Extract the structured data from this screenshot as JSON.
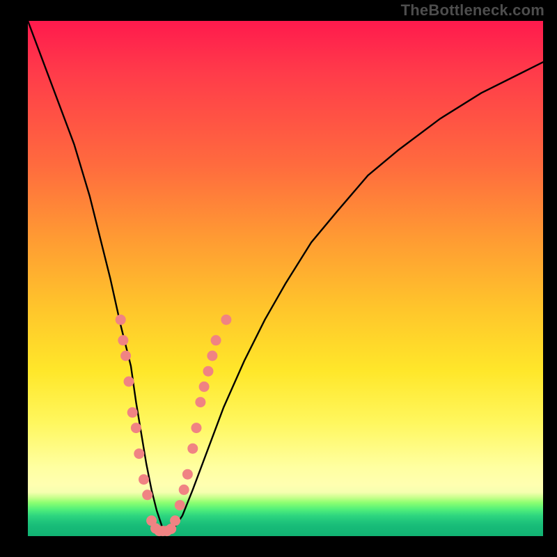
{
  "watermark": "TheBottleneck.com",
  "chart_data": {
    "type": "line",
    "title": "",
    "xlabel": "",
    "ylabel": "",
    "xlim": [
      0,
      100
    ],
    "ylim": [
      0,
      100
    ],
    "series": [
      {
        "name": "bottleneck-curve",
        "x": [
          0,
          3,
          6,
          9,
          12,
          14,
          16,
          18,
          20,
          21,
          22,
          23,
          24,
          25,
          26,
          27,
          28,
          30,
          32,
          35,
          38,
          42,
          46,
          50,
          55,
          60,
          66,
          72,
          80,
          88,
          96,
          100
        ],
        "values": [
          100,
          92,
          84,
          76,
          66,
          58,
          50,
          41,
          33,
          26,
          20,
          14,
          9,
          5,
          2,
          1,
          1,
          4,
          9,
          17,
          25,
          34,
          42,
          49,
          57,
          63,
          70,
          75,
          81,
          86,
          90,
          92
        ]
      }
    ],
    "markers": {
      "name": "highlighted-points",
      "color": "#f08383",
      "points": [
        {
          "x": 18.0,
          "y": 42
        },
        {
          "x": 18.5,
          "y": 38
        },
        {
          "x": 19.0,
          "y": 35
        },
        {
          "x": 19.6,
          "y": 30
        },
        {
          "x": 20.3,
          "y": 24
        },
        {
          "x": 21.0,
          "y": 21
        },
        {
          "x": 21.6,
          "y": 16
        },
        {
          "x": 22.5,
          "y": 11
        },
        {
          "x": 23.2,
          "y": 8
        },
        {
          "x": 24.0,
          "y": 3
        },
        {
          "x": 24.8,
          "y": 1.5
        },
        {
          "x": 25.5,
          "y": 1
        },
        {
          "x": 26.2,
          "y": 1
        },
        {
          "x": 27.0,
          "y": 1
        },
        {
          "x": 27.8,
          "y": 1.4
        },
        {
          "x": 28.6,
          "y": 3
        },
        {
          "x": 29.5,
          "y": 6
        },
        {
          "x": 30.3,
          "y": 9
        },
        {
          "x": 31.0,
          "y": 12
        },
        {
          "x": 32.0,
          "y": 17
        },
        {
          "x": 32.7,
          "y": 21
        },
        {
          "x": 33.5,
          "y": 26
        },
        {
          "x": 34.2,
          "y": 29
        },
        {
          "x": 35.0,
          "y": 32
        },
        {
          "x": 35.8,
          "y": 35
        },
        {
          "x": 36.5,
          "y": 38
        },
        {
          "x": 38.5,
          "y": 42
        }
      ]
    }
  }
}
